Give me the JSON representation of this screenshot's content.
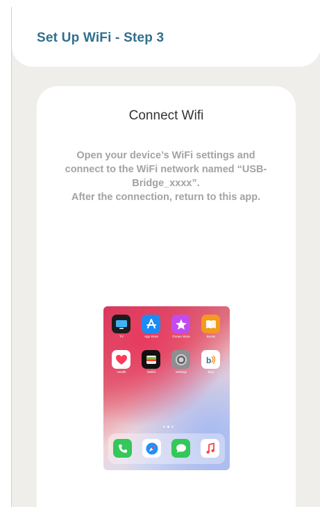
{
  "header": {
    "title": "Set Up WiFi - Step 3"
  },
  "card": {
    "title": "Connect Wifi",
    "instruction_lines": [
      "Open your device’s WiFi settings and",
      "connect to the WiFi network named “USB-",
      "Bridge_xxxx”.",
      "After the connection, return to this app."
    ]
  },
  "phone_preview": {
    "apps": [
      {
        "label": "TV",
        "icon": "tv-icon",
        "color": "#1c1c1e"
      },
      {
        "label": "App Store",
        "icon": "app-store-icon",
        "color": "#1b8cf5"
      },
      {
        "label": "iTunes Store",
        "icon": "itunes-store-icon",
        "color": "#c24bf0"
      },
      {
        "label": "Books",
        "icon": "books-icon",
        "color": "#f39a1f"
      },
      {
        "label": "Health",
        "icon": "health-icon",
        "color": "#ffffff"
      },
      {
        "label": "Wallet",
        "icon": "wallet-icon",
        "color": "#111111"
      },
      {
        "label": "Settings",
        "icon": "settings-icon",
        "color": "#8e8e93"
      },
      {
        "label": "Bioy",
        "icon": "bioy-icon",
        "color": "#ffffff"
      }
    ],
    "dock": [
      {
        "icon": "phone-icon",
        "color": "#34c759"
      },
      {
        "icon": "safari-icon",
        "color": "#ffffff"
      },
      {
        "icon": "messages-icon",
        "color": "#34c759"
      },
      {
        "icon": "music-icon",
        "color": "#ffffff"
      }
    ]
  }
}
